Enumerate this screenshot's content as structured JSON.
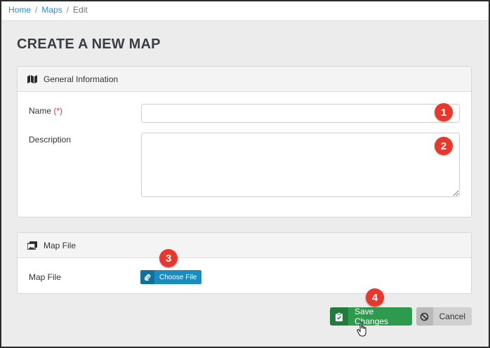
{
  "breadcrumb": {
    "home": "Home",
    "maps": "Maps",
    "current": "Edit",
    "separator": "/"
  },
  "page": {
    "title": "CREATE A NEW MAP"
  },
  "general_info": {
    "header": "General Information",
    "icon": "map-icon",
    "name_label": "Name",
    "required_marker": "(*)",
    "name_value": "",
    "description_label": "Description",
    "description_value": ""
  },
  "map_file": {
    "header": "Map File",
    "icon": "images-icon",
    "label": "Map File",
    "choose_button": "Choose File"
  },
  "actions": {
    "save": "Save Changes",
    "cancel": "Cancel"
  },
  "callouts": {
    "one": "1",
    "two": "2",
    "three": "3",
    "four": "4"
  },
  "colors": {
    "link": "#2a8bd8",
    "callout": "#e8372c",
    "save": "#2e9a4e",
    "file_button": "#1a8cc0",
    "cancel": "#d0d0d0"
  }
}
